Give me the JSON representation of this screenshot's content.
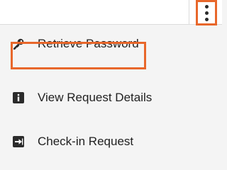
{
  "menu": {
    "items": [
      {
        "label": "Retrieve Password",
        "icon": "key-icon"
      },
      {
        "label": "View Request Details",
        "icon": "info-icon"
      },
      {
        "label": "Check-in Request",
        "icon": "check-in-icon"
      }
    ]
  },
  "colors": {
    "highlight": "#e8672b",
    "text": "#1f1f1f",
    "icon": "#2b2b2b",
    "background": "#f4f4f4"
  }
}
